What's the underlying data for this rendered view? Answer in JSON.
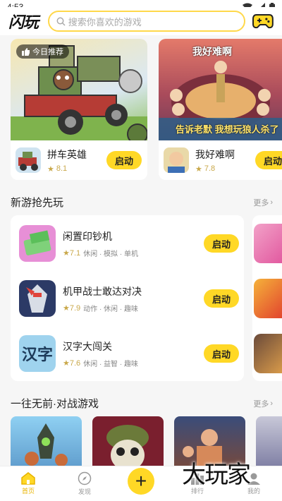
{
  "status": {
    "time": "4:53"
  },
  "header": {
    "logo": "闪玩",
    "search_placeholder": "搜索你喜欢的游戏"
  },
  "featured": [
    {
      "badge": "今日推荐",
      "name": "拼车英雄",
      "rating": "8.1",
      "launch": "启动"
    },
    {
      "banner_title": "我好难啊",
      "banner_slogan": "告诉老默 我想玩狼人杀了",
      "name": "我好难啊",
      "rating": "7.8",
      "launch": "启动"
    }
  ],
  "new_section": {
    "title": "新游抢先玩",
    "more": "更多"
  },
  "new_games": [
    {
      "name": "闲置印钞机",
      "score": "7.1",
      "tags": "休闲 · 模拟 · 单机",
      "launch": "启动"
    },
    {
      "name": "机甲战士敢达对决",
      "score": "7.9",
      "tags": "动作 · 休闲 · 趣味",
      "launch": "启动"
    },
    {
      "name": "汉字大闯关",
      "score": "7.6",
      "tags": "休闲 · 益智 · 趣味",
      "launch": "启动",
      "icon_text": "汉字"
    }
  ],
  "battle_section": {
    "title": "一往无前·对战游戏",
    "more": "更多"
  },
  "tabs": [
    {
      "label": "首页"
    },
    {
      "label": "发现"
    },
    {
      "label": ""
    },
    {
      "label": "排行"
    },
    {
      "label": "我的"
    }
  ],
  "watermark": "大玩家",
  "colors": {
    "accent": "#ffd826",
    "rating": "#c9a84a"
  }
}
